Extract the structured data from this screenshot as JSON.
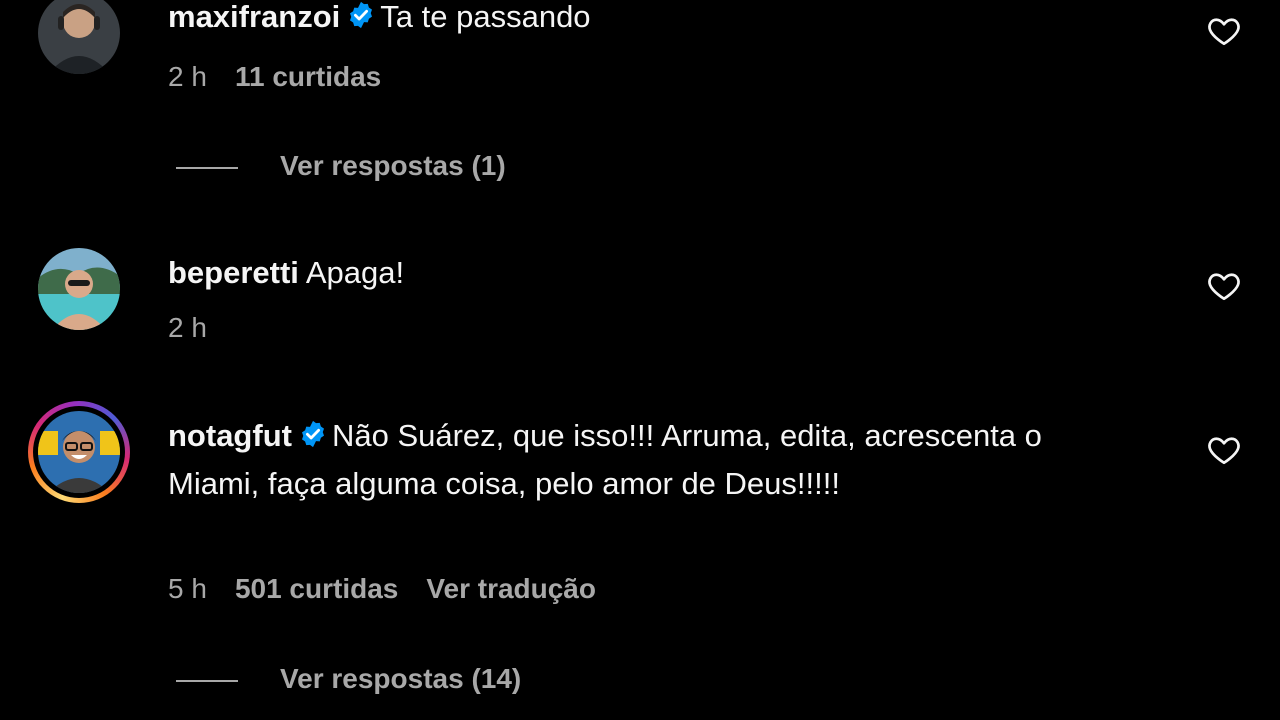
{
  "comments": [
    {
      "username": "maxifranzoi",
      "verified": true,
      "text": "Ta te passando",
      "time": "2 h",
      "likes": "11 curtidas",
      "replies": "Ver respostas (1)"
    },
    {
      "username": "beperetti",
      "verified": false,
      "text": "Apaga!",
      "time": "2 h"
    },
    {
      "username": "notagfut",
      "verified": true,
      "text": "Não Suárez, que isso!!! Arruma, edita, acrescenta o Miami, faça alguma coisa, pelo amor de Deus!!!!!",
      "time": "5 h",
      "likes": "501 curtidas",
      "translate": "Ver tradução",
      "replies": "Ver respostas (14)"
    }
  ],
  "colors": {
    "background": "#000000",
    "text": "#f5f5f5",
    "muted": "#a8a8a8",
    "verified": "#0095f6"
  },
  "icons": {
    "like": "heart-outline-icon",
    "verified": "verified-badge-icon"
  }
}
